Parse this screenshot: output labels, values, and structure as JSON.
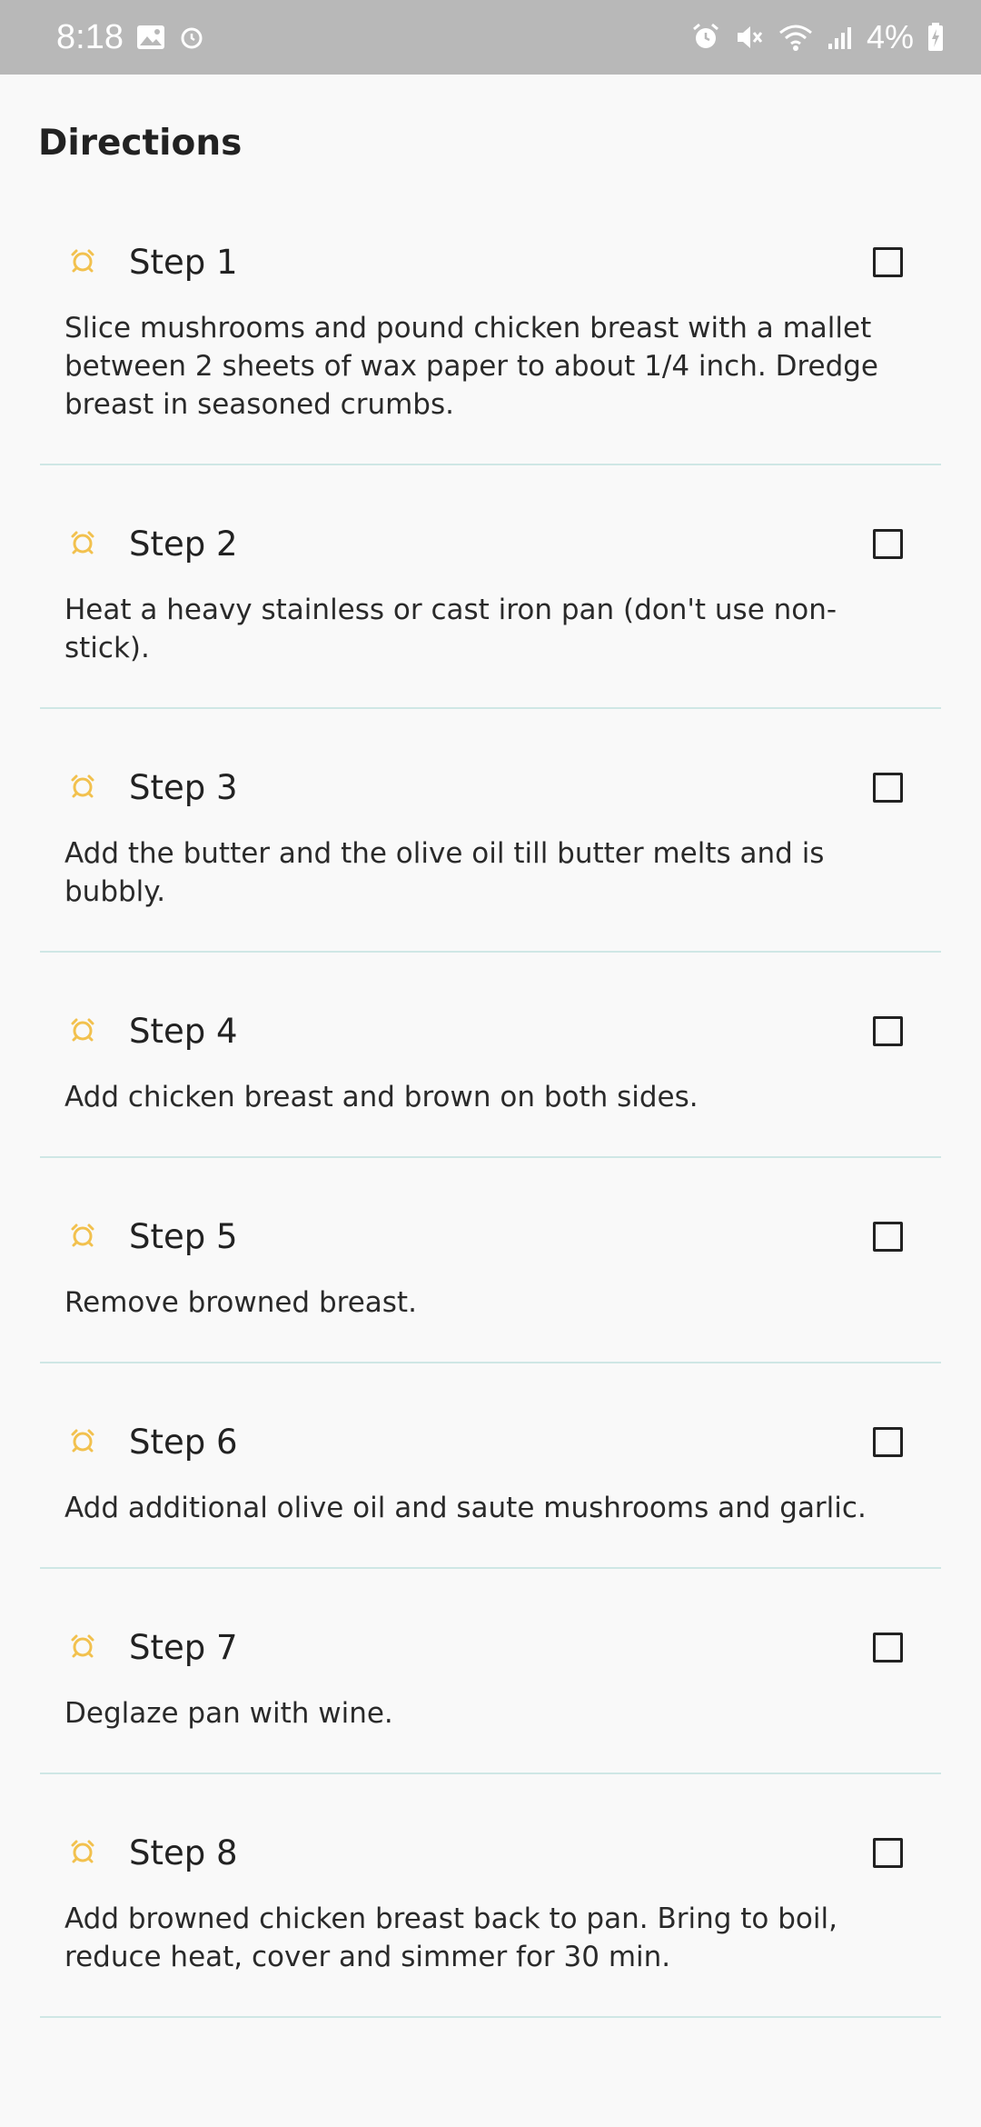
{
  "status_bar": {
    "time": "8:18",
    "battery": "4%",
    "left_icons": [
      "image-icon",
      "alarm-clock-icon"
    ],
    "right_icons": [
      "alarm-icon",
      "mute-icon",
      "wifi-icon",
      "signal-icon",
      "battery-charging-icon"
    ]
  },
  "directions": {
    "title": "Directions",
    "accent_color": "#f2c14e",
    "divider_color": "#cfe7e5",
    "steps": [
      {
        "label": "Step 1",
        "text": "Slice mushrooms and pound chicken breast with a mallet between 2 sheets of wax paper to about 1/4 inch. Dredge breast in seasoned crumbs.",
        "checked": false
      },
      {
        "label": "Step 2",
        "text": "Heat a heavy stainless or cast iron pan (don't use non-stick).",
        "checked": false
      },
      {
        "label": "Step 3",
        "text": "Add the butter and the olive oil till butter melts and is bubbly.",
        "checked": false
      },
      {
        "label": "Step 4",
        "text": "Add chicken breast and brown on both sides.",
        "checked": false
      },
      {
        "label": "Step 5",
        "text": "Remove browned breast.",
        "checked": false
      },
      {
        "label": "Step 6",
        "text": "Add additional olive oil and saute mushrooms and garlic.",
        "checked": false
      },
      {
        "label": "Step 7",
        "text": "Deglaze pan with wine.",
        "checked": false
      },
      {
        "label": "Step 8",
        "text": "Add browned chicken breast back to pan. Bring to boil, reduce heat, cover and simmer for 30 min.",
        "checked": false
      }
    ]
  }
}
